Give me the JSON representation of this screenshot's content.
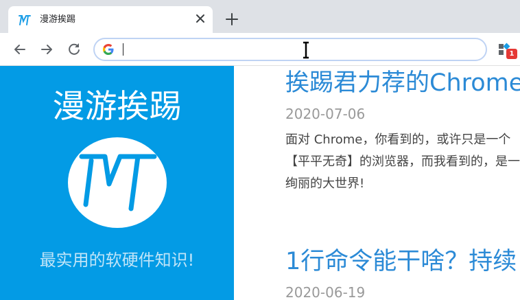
{
  "browser": {
    "tab": {
      "title": "漫游挨踢",
      "favicon": "mt-logo-icon"
    },
    "omnibox": {
      "value": "",
      "search_engine_icon": "google-g-icon"
    },
    "extension": {
      "badge": "1"
    },
    "colors": {
      "tabstrip": "#dee1e6",
      "omnibox_border": "#bfd3f4"
    }
  },
  "sidebar": {
    "site_title": "漫游挨踢",
    "logo": "mt-logo",
    "tagline": "最实用的软硬件知识!",
    "background": "#039be5"
  },
  "posts": [
    {
      "title": "挨踢君力荐的Chrome",
      "date": "2020-07-06",
      "excerpt": "面对 Chrome，你看到的，或许只是一个【平平无奇】的浏览器，而我看到的，是一个绚丽的大世界!"
    },
    {
      "title": "1行命令能干啥？持续",
      "date": "2020-06-19",
      "excerpt": ""
    }
  ]
}
